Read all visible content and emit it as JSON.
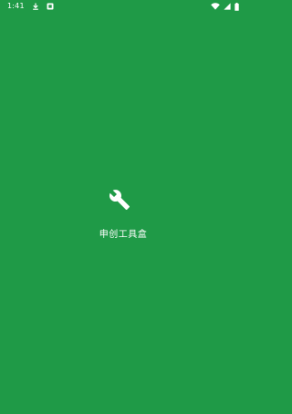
{
  "status_bar": {
    "time": "1:41",
    "icons": [
      "download-icon",
      "notification-box-icon",
      "wifi-icon",
      "cellular-icon",
      "battery-icon"
    ]
  },
  "splash": {
    "logo_icon": "wrench-icon",
    "app_name": "申创工具盒"
  },
  "colors": {
    "background": "#1f9a47",
    "foreground": "#ffffff"
  }
}
